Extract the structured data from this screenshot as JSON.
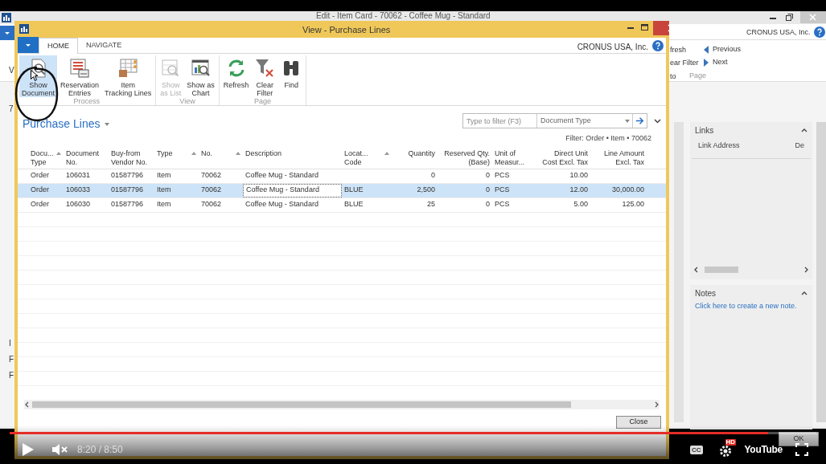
{
  "background_window": {
    "title": "Edit - Item Card - 70062 - Coffee Mug - Standard",
    "company": "CRONUS USA, Inc.",
    "left_fragments": [
      "V",
      "7",
      "I",
      "F",
      "F"
    ],
    "ribbon_fragments": [
      "fresh",
      "ear Filter",
      "to"
    ],
    "nav_buttons": [
      {
        "label": "Previous",
        "kind": "previous"
      },
      {
        "label": "Next",
        "kind": "next"
      }
    ],
    "group_label": "Page",
    "factboxes": [
      {
        "kind": "links",
        "title": "Links",
        "expanded": true,
        "columns": [
          "Link Address",
          "De"
        ]
      },
      {
        "kind": "notes",
        "title": "Notes",
        "expanded": true,
        "link": "Click here to create a new note."
      }
    ],
    "ok_button": "OK"
  },
  "dialog": {
    "title": "View - Purchase Lines",
    "tabs": [
      {
        "label": "HOME",
        "selected": true
      },
      {
        "label": "NAVIGATE",
        "selected": false
      }
    ],
    "company": "CRONUS USA, Inc.",
    "ribbon_groups": [
      {
        "label": "Process",
        "buttons": [
          {
            "label": "Show\nDocument",
            "selected": true,
            "disabled": false
          },
          {
            "label": "Reservation\nEntries",
            "selected": false,
            "disabled": false
          },
          {
            "label": "Item\nTracking Lines",
            "selected": false,
            "disabled": false
          }
        ]
      },
      {
        "label": "View",
        "buttons": [
          {
            "label": "Show\nas List",
            "selected": false,
            "disabled": true
          },
          {
            "label": "Show as\nChart",
            "selected": false,
            "disabled": false
          }
        ]
      },
      {
        "label": "Page",
        "buttons": [
          {
            "label": "Refresh",
            "selected": false,
            "disabled": false
          },
          {
            "label": "Clear\nFilter",
            "selected": false,
            "disabled": false
          },
          {
            "label": "Find",
            "selected": false,
            "disabled": false
          }
        ]
      }
    ],
    "page_title": "Purchase Lines",
    "filter_box": {
      "placeholder": "Type to filter (F3)",
      "field": "Document Type"
    },
    "filter_text": "Filter: Order • Item • 70062",
    "columns": [
      {
        "label": "Docu...\nType",
        "sort_arrow": true,
        "numeric": false
      },
      {
        "label": "Document\nNo.",
        "sort_arrow": false,
        "numeric": false
      },
      {
        "label": "Buy-from\nVendor No.",
        "sort_arrow": false,
        "numeric": false
      },
      {
        "label": "Type",
        "sort_arrow": true,
        "numeric": false
      },
      {
        "label": "No.",
        "sort_arrow": true,
        "numeric": false
      },
      {
        "label": "Description",
        "sort_arrow": false,
        "numeric": false
      },
      {
        "label": "Locat...\nCode",
        "sort_arrow": true,
        "numeric": false
      },
      {
        "label": "Quantity",
        "sort_arrow": false,
        "numeric": true
      },
      {
        "label": "Reserved Qty.\n(Base)",
        "sort_arrow": false,
        "numeric": true
      },
      {
        "label": "Unit of\nMeasur...",
        "sort_arrow": false,
        "numeric": false
      },
      {
        "label": "Direct Unit\nCost Excl. Tax",
        "sort_arrow": false,
        "numeric": true
      },
      {
        "label": "Line Amount\nExcl. Tax",
        "sort_arrow": false,
        "numeric": true
      }
    ],
    "rows": [
      {
        "selected": false,
        "focused": false,
        "cells": [
          "Order",
          "106031",
          "01587796",
          "Item",
          "70062",
          "Coffee Mug - Standard",
          "",
          "0",
          "0",
          "PCS",
          "10.00",
          ""
        ]
      },
      {
        "selected": true,
        "focused": true,
        "cells": [
          "Order",
          "106033",
          "01587796",
          "Item",
          "70062",
          "Coffee Mug - Standard",
          "BLUE",
          "2,500",
          "0",
          "PCS",
          "12.00",
          "30,000.00"
        ]
      },
      {
        "selected": false,
        "focused": false,
        "cells": [
          "Order",
          "106030",
          "01587796",
          "Item",
          "70062",
          "Coffee Mug - Standard",
          "BLUE",
          "25",
          "0",
          "PCS",
          "5.00",
          "125.00"
        ]
      }
    ],
    "close_button": "Close"
  },
  "video_player": {
    "progress": {
      "level": 0.94
    },
    "muted": true,
    "time": "8:20 / 8:50",
    "captions": "CC",
    "quality_badge": "HD",
    "logo": "YouTube"
  }
}
